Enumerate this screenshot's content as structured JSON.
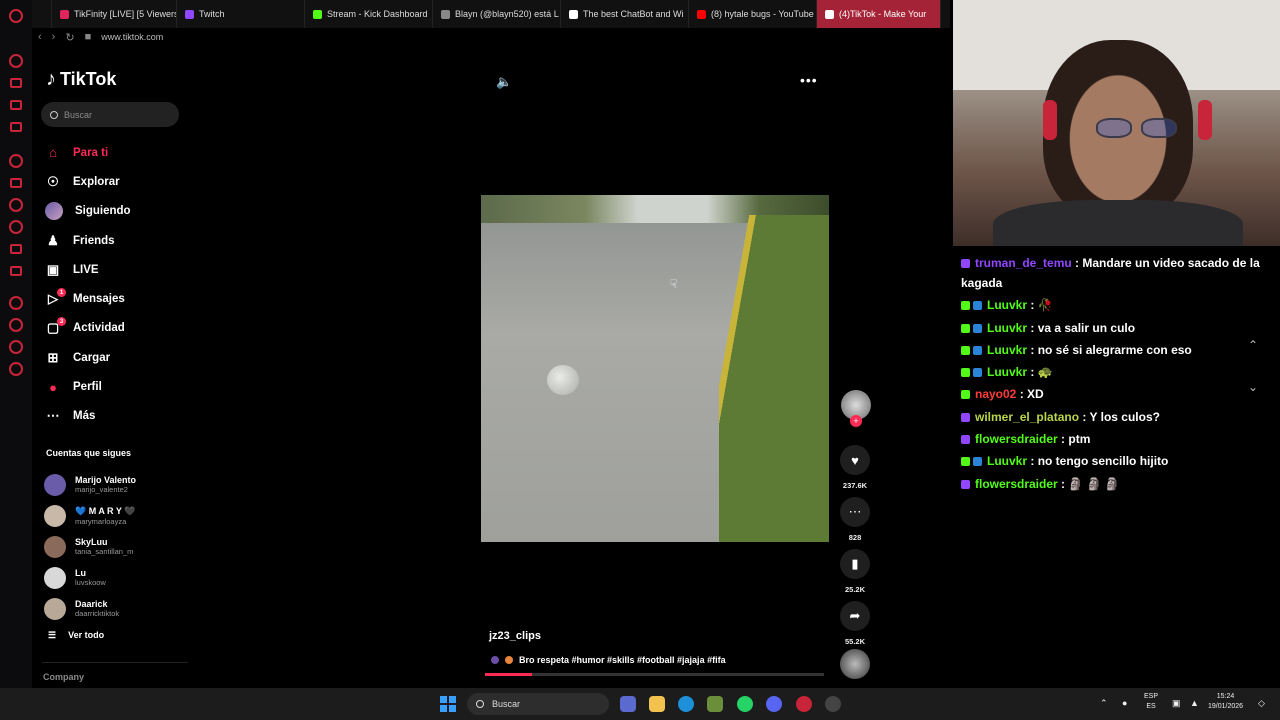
{
  "browser": {
    "tabs": [
      {
        "label": "TikFinity [LIVE] [5 Viewers",
        "color": "#e0245e"
      },
      {
        "label": "Twitch",
        "color": "#9146ff"
      },
      {
        "label": "Stream - Kick Dashboard",
        "color": "#53fc18"
      },
      {
        "label": "Blayn (@blayn520) está L",
        "color": "#888888"
      },
      {
        "label": "The best ChatBot and Wi",
        "color": "#ffffff"
      },
      {
        "label": "(8) hytale bugs - YouTube",
        "color": "#ff0000"
      },
      {
        "label": "(4)TikTok - Make Your",
        "color": "#ffffff"
      }
    ],
    "url": "www.tiktok.com"
  },
  "tiktok": {
    "logo": "TikTok",
    "search_placeholder": "Buscar",
    "menu": [
      {
        "label": "Para ti",
        "icon": "home-icon"
      },
      {
        "label": "Explorar",
        "icon": "compass-icon"
      },
      {
        "label": "Siguiendo",
        "icon": "avatar-icon"
      },
      {
        "label": "Friends",
        "icon": "friends-icon"
      },
      {
        "label": "LIVE",
        "icon": "tv-icon"
      },
      {
        "label": "Mensajes",
        "icon": "message-icon",
        "badge": "1"
      },
      {
        "label": "Actividad",
        "icon": "inbox-icon",
        "badge": "3"
      },
      {
        "label": "Cargar",
        "icon": "upload-icon"
      },
      {
        "label": "Perfil",
        "icon": "profile-icon"
      },
      {
        "label": "Más",
        "icon": "more-icon"
      }
    ],
    "following_title": "Cuentas que sigues",
    "following": [
      {
        "name": "Marijo Valento",
        "user": "marijo_valente2",
        "color": "#6a5ca8"
      },
      {
        "name": "💙 M A R Y 🖤",
        "user": "marymarloayza",
        "color": "#c7b8a8"
      },
      {
        "name": "SkyLuu",
        "user": "tania_santillan_m",
        "color": "#8a6a5a"
      },
      {
        "name": "Lu",
        "user": "luvskoow",
        "color": "#d8d8d8"
      },
      {
        "name": "Daarick",
        "user": "daarricktiktok",
        "color": "#b8a898"
      }
    ],
    "see_all": "Ver todo",
    "company": "Company",
    "video": {
      "username": "jz23_clips",
      "description": "Bro respeta #humor #skills #football #jajaja #fifa",
      "progress": 0.14,
      "likes": "237.6K",
      "comments": "828",
      "saves": "25.2K",
      "shares": "55.2K"
    }
  },
  "chat": [
    {
      "platform": "twitch",
      "user": "truman_de_temu",
      "color": "#9146ff",
      "text": "Mandare un video sacado de la kagada"
    },
    {
      "platform": "kick",
      "verified": true,
      "user": "Luuvkr",
      "color": "#53fc18",
      "text": "🥀"
    },
    {
      "platform": "kick",
      "verified": true,
      "user": "Luuvkr",
      "color": "#53fc18",
      "text": "va a salir un culo"
    },
    {
      "platform": "kick",
      "verified": true,
      "user": "Luuvkr",
      "color": "#53fc18",
      "text": "no sé si alegrarme con eso"
    },
    {
      "platform": "kick",
      "verified": true,
      "user": "Luuvkr",
      "color": "#53fc18",
      "text": "🐢"
    },
    {
      "platform": "kick",
      "verified": false,
      "user": "nayo02",
      "color": "#ff3b3b",
      "text": "XD"
    },
    {
      "platform": "twitch",
      "user": "wilmer_el_platano",
      "color": "#b8d44a",
      "text": "Y los culos?"
    },
    {
      "platform": "twitch",
      "user": "flowersdraider",
      "color": "#53fc18",
      "text": "ptm"
    },
    {
      "platform": "kick",
      "verified": true,
      "user": "Luuvkr",
      "color": "#53fc18",
      "text": "no tengo sencillo hijito"
    },
    {
      "platform": "twitch",
      "user": "flowersdraider",
      "color": "#53fc18",
      "text": "🗿 🗿 🗿"
    }
  ],
  "taskbar": {
    "search": "Buscar",
    "lang_top": "ESP",
    "lang_bottom": "ES",
    "time": "15:24",
    "date": "19/01/2026"
  }
}
